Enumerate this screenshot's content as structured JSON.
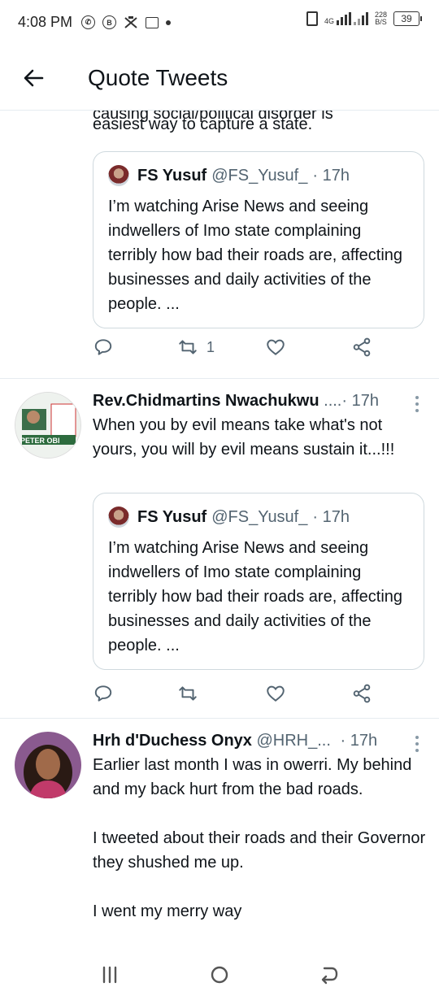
{
  "status_bar": {
    "time": "4:08 PM",
    "network_type": "4G",
    "data_rate": "228",
    "data_unit": "B/S",
    "battery": "39"
  },
  "header": {
    "title": "Quote Tweets"
  },
  "tweets": [
    {
      "text_partial": "causing social/political disorder is",
      "text": "easiest way to capture a state.",
      "quote": {
        "name": "FS Yusuf",
        "handle": "@FS_Yusuf_",
        "time": "· 17h",
        "text": "I’m watching Arise News and seeing indwellers of Imo state complaining terribly how bad their roads are, affecting businesses and daily activities of the people. ..."
      },
      "retweet_count": "1"
    },
    {
      "name": "Rev.Chidmartins Nwachukwu",
      "handle": "....",
      "time": "· 17h",
      "text": "When you by evil means take what's not yours, you will by evil means sustain it...!!!",
      "avatar_text": "PETER OBI",
      "quote": {
        "name": "FS Yusuf",
        "handle": "@FS_Yusuf_",
        "time": "· 17h",
        "text": "I’m watching Arise News and seeing indwellers of Imo state complaining terribly how bad their roads are, affecting businesses and daily activities of the people. ..."
      },
      "retweet_count": ""
    },
    {
      "name": "Hrh d'Duchess Onyx",
      "handle": "@HRH_...",
      "time": "· 17h",
      "text": "Earlier last month I was in owerri. My behind and my back hurt from the bad roads.\n\nI tweeted about their roads and their Governor they shushed me up.\n\nI went my merry way"
    }
  ],
  "icons": {
    "reply": "comment-icon",
    "retweet": "retweet-icon",
    "like": "heart-icon",
    "share": "share-icon"
  },
  "colors": {
    "text": "#0f1419",
    "secondary": "#536471",
    "border": "#cfd9de"
  }
}
